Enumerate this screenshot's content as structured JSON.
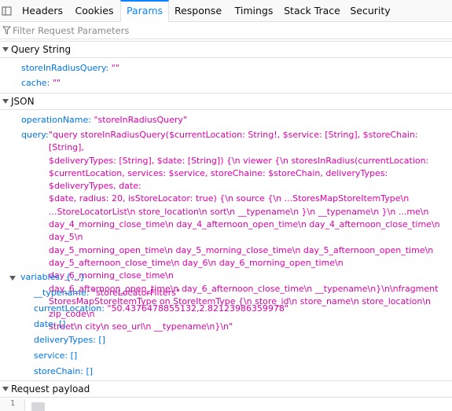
{
  "tabs": [
    {
      "label": "Headers"
    },
    {
      "label": "Cookies"
    },
    {
      "label": "Params"
    },
    {
      "label": "Response"
    },
    {
      "label": "Timings"
    },
    {
      "label": "Stack Trace"
    },
    {
      "label": "Security"
    }
  ],
  "selected_tab": "Params",
  "filter": {
    "placeholder": "Filter Request Parameters",
    "value": ""
  },
  "query_string": {
    "title": "Query String",
    "params": [
      {
        "key": "storeInRadiusQuery:",
        "value": "\"\""
      },
      {
        "key": "cache:",
        "value": "\"\""
      }
    ]
  },
  "json": {
    "title": "JSON",
    "operationName": {
      "key": "operationName:",
      "value": "\"storeInRadiusQuery\""
    },
    "query": {
      "key": "query:",
      "lines": [
        "\"query storeInRadiusQuery($currentLocation: String!, $service: [String], $storeChain: [String],",
        "$deliveryTypes: [String], $date: [String]) {\\n viewer {\\n storesInRadius(currentLocation:",
        "$currentLocation, services: $service, storeChaine: $storeChain, deliveryTypes: $deliveryTypes, date:",
        "$date, radius: 20, isStoreLocator: true) {\\n source {\\n ...StoresMapStoreItemType\\n",
        "...StoreLocatorList\\n store_location\\n sort\\n __typename\\n }\\n __typename\\n }\\n ...me\\n",
        "day_4_morning_close_time\\n day_4_afternoon_open_time\\n day_4_afternoon_close_time\\n day_5\\n",
        "day_5_morning_open_time\\n day_5_morning_close_time\\n day_5_afternoon_open_time\\n",
        "day_5_afternoon_close_time\\n day_6\\n day_6_morning_open_time\\n day_6_morning_close_time\\n",
        "day_6_afternoon_open_time\\n day_6_afternoon_close_time\\n __typename\\n}\\n\\nfragment",
        "StoresMapStoreItemType on StoreItemType {\\n store_id\\n store_name\\n store_location\\n zip_code\\n",
        "street\\n city\\n seo_url\\n __typename\\n}\\n\""
      ]
    },
    "variables": {
      "key": "variables:",
      "summary": "{…}",
      "items": [
        {
          "key": "__typename:",
          "value": "\"storeLocatorFilters\""
        },
        {
          "key": "currentLocation:",
          "value": "\"50.4376478855132,2.82123986359978\""
        },
        {
          "key": "date:",
          "value": "[]"
        },
        {
          "key": "deliveryTypes:",
          "value": "[]"
        },
        {
          "key": "service:",
          "value": "[]"
        },
        {
          "key": "storeChain:",
          "value": "[]"
        }
      ]
    }
  },
  "request_payload": {
    "title": "Request payload",
    "line_number": "1"
  }
}
